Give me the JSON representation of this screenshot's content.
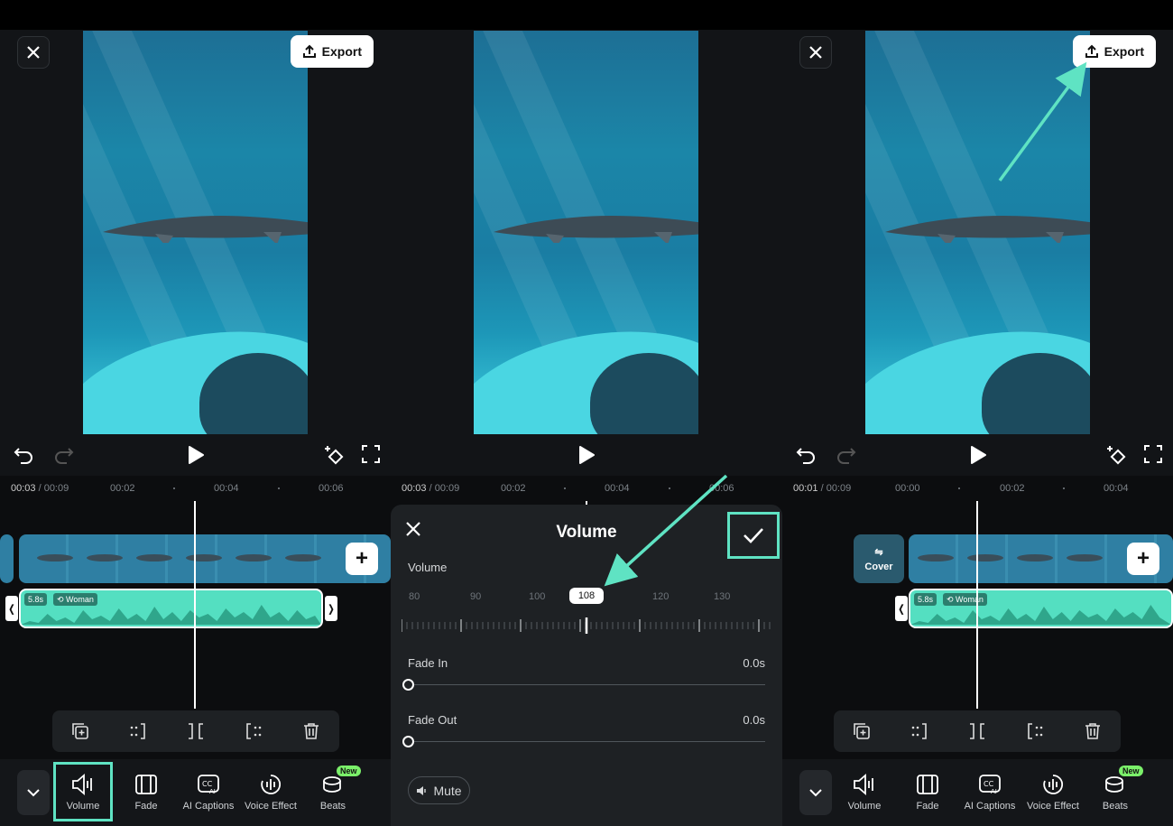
{
  "panels": [
    {
      "export_label": "Export",
      "time_current": "00:03",
      "time_total": " / 00:09",
      "ticks": [
        "00:02",
        "00:04",
        "00:06"
      ],
      "clip_badge_duration": "5.8s",
      "clip_badge_voice": "Woman",
      "cover_label": "",
      "tools": [
        {
          "label": "Volume",
          "icon": "volume-icon",
          "selected": true
        },
        {
          "label": "Fade",
          "icon": "fade-icon"
        },
        {
          "label": "AI Captions",
          "icon": "ai-captions-icon"
        },
        {
          "label": "Voice Effect",
          "icon": "voice-effect-icon"
        },
        {
          "label": "Beats",
          "icon": "beats-icon",
          "badge": "New"
        }
      ]
    },
    {
      "time_current": "00:03",
      "time_total": " / 00:09",
      "ticks": [
        "00:02",
        "00:04",
        "00:06"
      ]
    },
    {
      "export_label": "Export",
      "time_current": "00:01",
      "time_total": " / 00:09",
      "ticks": [
        "00:00",
        "00:02",
        "00:04"
      ],
      "clip_badge_duration": "5.8s",
      "clip_badge_voice": "Woman",
      "cover_label": "Cover",
      "tools": [
        {
          "label": "Volume",
          "icon": "volume-icon"
        },
        {
          "label": "Fade",
          "icon": "fade-icon"
        },
        {
          "label": "AI Captions",
          "icon": "ai-captions-icon"
        },
        {
          "label": "Voice Effect",
          "icon": "voice-effect-icon"
        },
        {
          "label": "Beats",
          "icon": "beats-icon",
          "badge": "New"
        }
      ]
    }
  ],
  "volume_sheet": {
    "title": "Volume",
    "volume_label": "Volume",
    "scale": [
      "80",
      "90",
      "100",
      "120",
      "130"
    ],
    "current_value": "108",
    "fade_in_label": "Fade In",
    "fade_in_value": "0.0s",
    "fade_out_label": "Fade Out",
    "fade_out_value": "0.0s",
    "mute_label": "Mute"
  },
  "accent_color": "#5fe3c3",
  "audio_color": "#54dfc1"
}
